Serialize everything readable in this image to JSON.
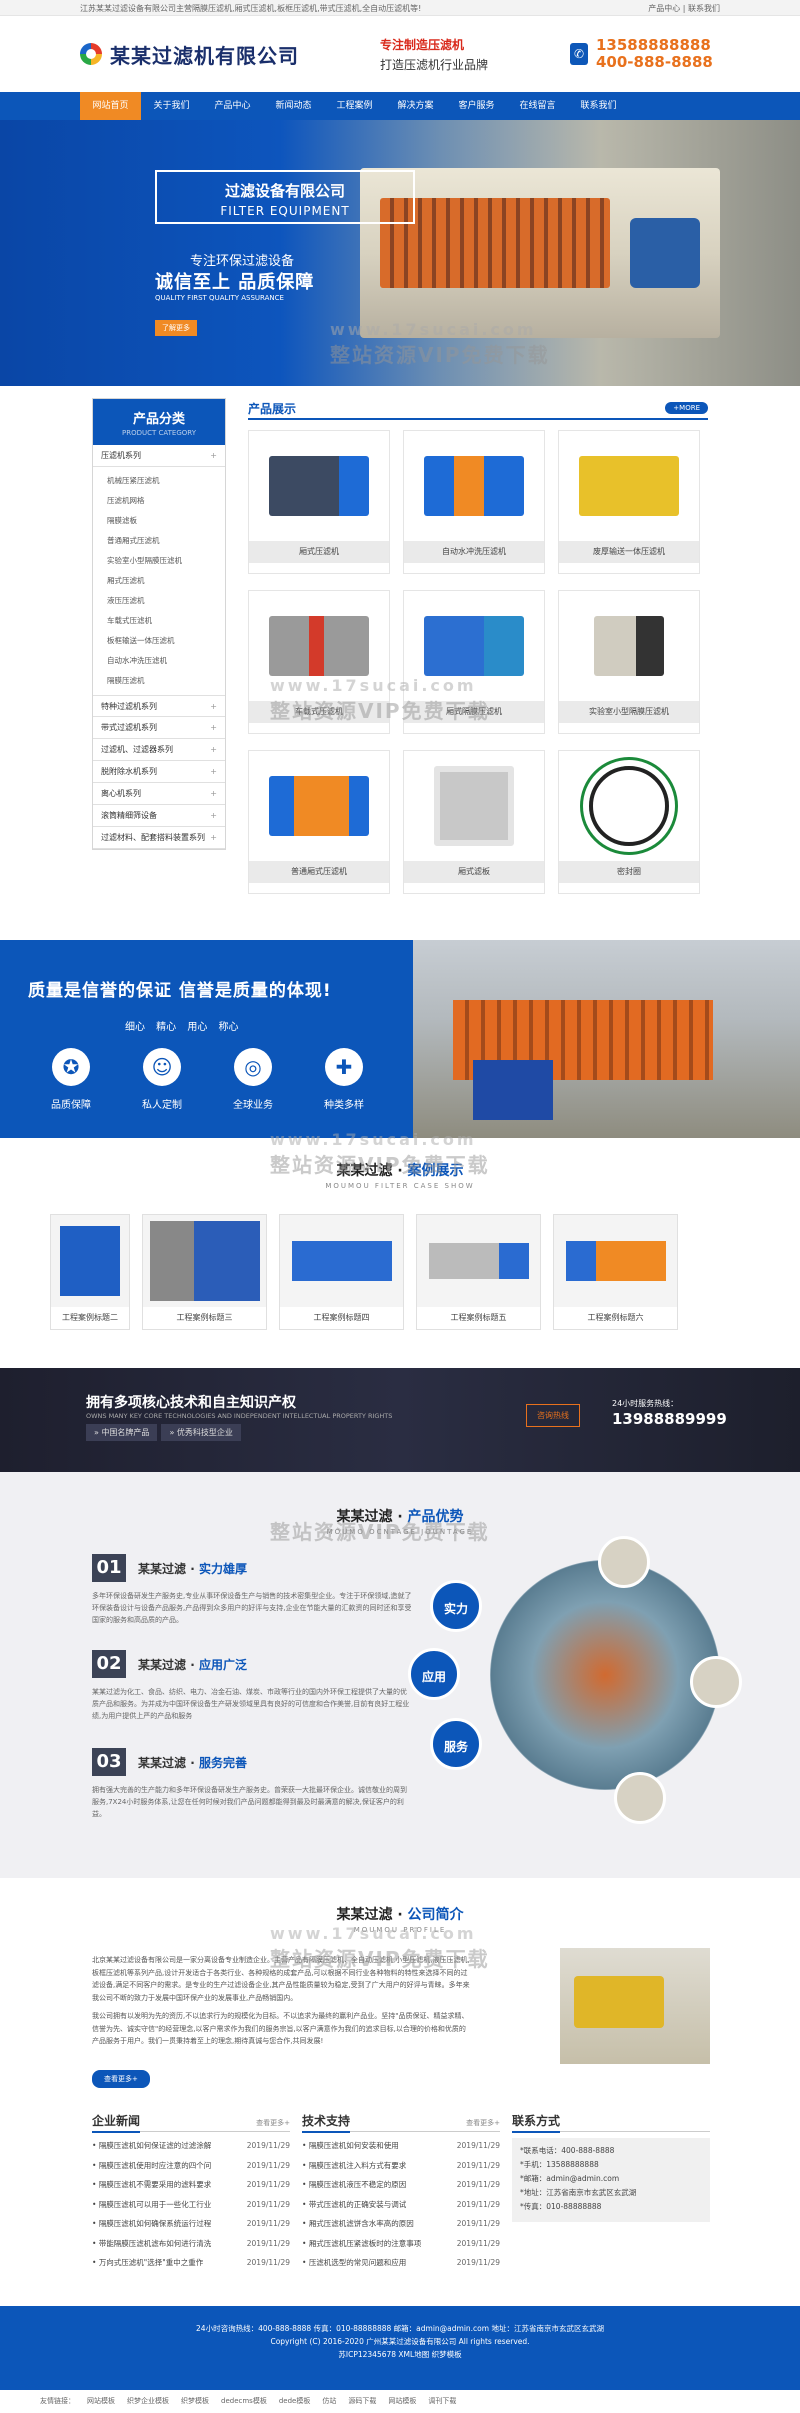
{
  "topbar": {
    "notice": "江苏某某过滤设备有限公司主营隔膜压滤机,厢式压滤机,板框压滤机,带式压滤机,全自动压滤机等!",
    "links": "产品中心 | 联系我们"
  },
  "header": {
    "company": "某某过滤机有限公司",
    "slogan1": "专注制造压滤机",
    "slogan2": "打造压滤机行业品牌",
    "phone1": "13588888888",
    "phone2": "400-888-8888"
  },
  "nav": [
    "网站首页",
    "关于我们",
    "产品中心",
    "新闻动态",
    "工程案例",
    "解决方案",
    "客户服务",
    "在线留言",
    "联系我们"
  ],
  "banner": {
    "title": "过滤设备有限公司",
    "title_en": "FILTER EQUIPMENT",
    "line1": "专注环保过滤设备",
    "line2": "诚信至上  品质保障",
    "line3": "QUALITY FIRST QUALITY ASSURANCE",
    "button": "了解更多"
  },
  "watermark": {
    "url": "www.17sucai.com",
    "text": "整站资源VIP免费下载"
  },
  "sidebar": {
    "title": "产品分类",
    "title_en": "PRODUCT CATEGORY",
    "cat1": "压滤机系列",
    "subs": [
      "机械压紧压滤机",
      "压滤机网格",
      "隔膜滤板",
      "普通厢式压滤机",
      "实验室小型隔膜压滤机",
      "厢式压滤机",
      "液压压滤机",
      "车载式压滤机",
      "板框输送一体压滤机",
      "自动水冲洗压滤机",
      "隔膜压滤机"
    ],
    "cats": [
      "特种过滤机系列",
      "带式过滤机系列",
      "过滤机、过滤器系列",
      "脱附除水机系列",
      "离心机系列",
      "滚筒精细筛设备",
      "过滤材料、配套搭料装置系列"
    ]
  },
  "products": {
    "title": "产品展示",
    "more": "+MORE",
    "items": [
      "厢式压滤机",
      "自动水冲洗压滤机",
      "废厚输送一体压滤机",
      "车载式压滤机",
      "厢式隔膜压滤机",
      "实验室小型隔膜压滤机",
      "普通厢式压滤机",
      "厢式滤板",
      "密封圈"
    ]
  },
  "quality": {
    "title": "质量是信誉的保证  信誉是质量的体现!",
    "sub": "细心 精心 用心 称心",
    "icons": [
      "品质保障",
      "私人定制",
      "全球业务",
      "种类多样"
    ]
  },
  "cases": {
    "title_a": "某某过滤",
    "title_b": "案例展示",
    "sub": "MOUMOU FILTER CASE SHOW",
    "items": [
      "工程案例标题二",
      "工程案例标题三",
      "工程案例标题四",
      "工程案例标题五",
      "工程案例标题六"
    ]
  },
  "tech": {
    "title": "拥有多项核心技术和自主知识产权",
    "sub": "OWNS MANY KEY CORE TECHNOLOGIES AND INDEPENDENT INTELLECTUAL PROPERTY RIGHTS",
    "tags": [
      "中国名牌产品",
      "优秀科技型企业"
    ],
    "button": "咨询热线",
    "tel_label": "24小时服务热线：",
    "tel": "13988889999"
  },
  "advantages": {
    "title_a": "某某过滤",
    "title_b": "产品优势",
    "sub": "MOUMO   OCNTAGE   JOUNTAGE",
    "items": [
      {
        "num": "01",
        "brand": "某某过滤",
        "head": "实力雄厚",
        "text": "多年环保设备研发生产服务史,专业从事环保设备生产与销售的技术密集型企业。专注于环保领域,造就了环保装备设计与设备产品服务,产品得到众多用户的好评与支持,企业在节能大量的汇款资的同时还和享受国家的服务和高品质的产品。"
      },
      {
        "num": "02",
        "brand": "某某过滤",
        "head": "应用广泛",
        "text": "某某过滤为化工、食品、纺织、电力、冶金石油、煤炭、市政等行业的国内外环保工程提供了大量的优质产品和服务。为并成为中国环保设备生产研发领域里具有良好的可信度和合作美誉,目前有良好工程业绩,为用户提供上严的产品和服务"
      },
      {
        "num": "03",
        "brand": "某某过滤",
        "head": "服务完善",
        "text": "拥有强大完善的生产能力和多年环保设备研发生产服务史。曾荣获一大批最环保企业。诚信敬业的周到服务,7X24小时服务体系,让您在任何时候对我们产品问题都能得到最及时最满意的解决,保证客户的利益。"
      }
    ],
    "bubbles": [
      "实力",
      "应用",
      "服务"
    ]
  },
  "about": {
    "title_a": "某某过滤",
    "title_b": "公司简介",
    "sub": "MOUMOU   PROFILE",
    "para1": "北京某某过滤设备有限公司是一家分离设备专业制造企业。主营产品有隔膜压滤机、全自动压滤机,小型压滤机,液压压滤机,板框压滤机等系列产品,设计开发适合于各类行业、各种规格的成套产品,可以根据不同行业各种物料的特性来选择不同的过滤设备,满足不同客户的需求。是专业的生产过滤设备企业,其产品性能质量较为稳定,受到了广大用户的好评与青睐。多年来我公司不断的致力于发展中国环保产业的发展事业,产品畅销国内。",
    "para2": "我公司拥有以发明为先的资历,不以追求行为的规模化为目标。不以追求为最终的赢利产品业。坚持\"品质保证、精益求精、信誉为先、诚实守信\"的经营理念,以客户需求作为我们的服务宗旨,以客户满意作为我们的追求目标,以合理的价格和优质的产品服务于用户。我们一贯秉持着至上的理念,期待真诚与您合作,共同发展!",
    "button": "查看更多+"
  },
  "news": {
    "title": "企业新闻",
    "more": "查看更多+",
    "rows": [
      [
        "隔膜压滤机如何保证滤的过滤涂解",
        "2019/11/29"
      ],
      [
        "隔膜压滤机使用时应注意的四个问",
        "2019/11/29"
      ],
      [
        "隔膜压滤机不需要采用的滤料要求",
        "2019/11/29"
      ],
      [
        "隔膜压滤机可以用于一些化工行业",
        "2019/11/29"
      ],
      [
        "隔膜压滤机如何确保系统运行过程",
        "2019/11/29"
      ],
      [
        "带能隔膜压滤机滤布如何进行清洗",
        "2019/11/29"
      ],
      [
        "万向式压滤机\"选择\"重中之重作",
        "2019/11/29"
      ]
    ]
  },
  "support": {
    "title": "技术支持",
    "more": "查看更多+",
    "rows": [
      [
        "隔膜压滤机如何安装和使用",
        "2019/11/29"
      ],
      [
        "隔膜压滤机注入料方式有要求",
        "2019/11/29"
      ],
      [
        "隔膜压滤机液压不稳定的原因",
        "2019/11/29"
      ],
      [
        "带式压滤机的正确安装与调试",
        "2019/11/29"
      ],
      [
        "厢式压滤机滤饼含水率高的原因",
        "2019/11/29"
      ],
      [
        "厢式压滤机压紧滤板时的注意事项",
        "2019/11/29"
      ],
      [
        "压滤机选型的常见问题和应用",
        "2019/11/29"
      ]
    ]
  },
  "contact": {
    "title": "联系方式",
    "lines": [
      "*联系电话：400-888-8888",
      "*手机：13588888888",
      "*邮箱：admin@admin.com",
      "*地址：江苏省南京市玄武区玄武湖",
      "*传真：010-88888888"
    ]
  },
  "footer": {
    "line1": "24小时咨询热线：400-888-8888 传真：010-88888888 邮箱：admin@admin.com 地址：江苏省南京市玄武区玄武湖",
    "line2": "Copyright (C) 2016-2020 广州某某过滤设备有限公司 All rights reserved.",
    "line3": "苏ICP12345678 XML地图 织梦模板"
  },
  "links": [
    "友情链接：",
    "网站模板",
    "织梦企业模板",
    "织梦模板",
    "dedecms模板",
    "dede模板",
    "仿站",
    "源码下载",
    "网站模板",
    "调刊下载"
  ]
}
